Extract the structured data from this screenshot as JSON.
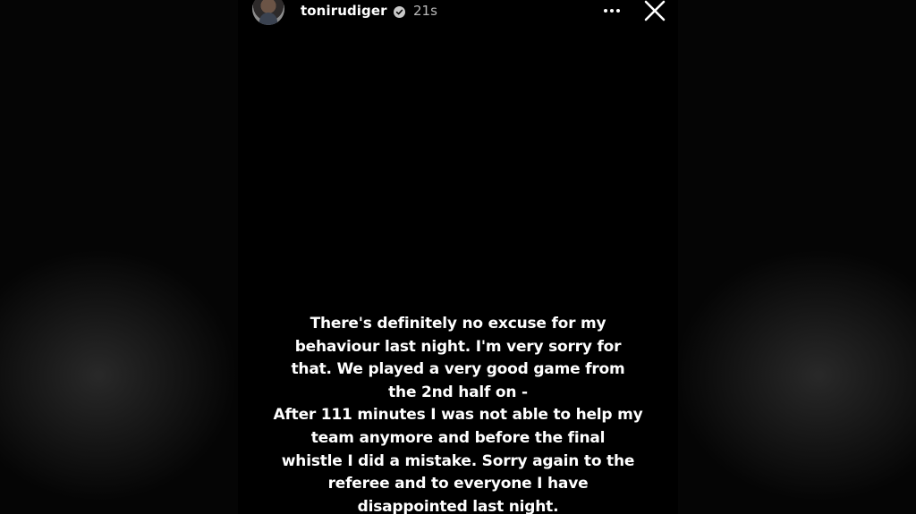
{
  "story": {
    "username": "tonirudiger",
    "timestamp": "21s",
    "icons": {
      "avatar": "profile-photo",
      "verified": "verified-badge-icon",
      "more": "more-options-icon",
      "close": "close-icon"
    },
    "caption_lines": [
      "There's definitely no excuse for my",
      "behaviour last night. I'm very sorry for",
      "that. We played a very good game from",
      "the 2nd half on -",
      "After 111 minutes I was not able to help my",
      "team anymore and before the final",
      "whistle I did a mistake. Sorry again to the",
      "referee and to everyone I have",
      "disappointed last night."
    ]
  }
}
